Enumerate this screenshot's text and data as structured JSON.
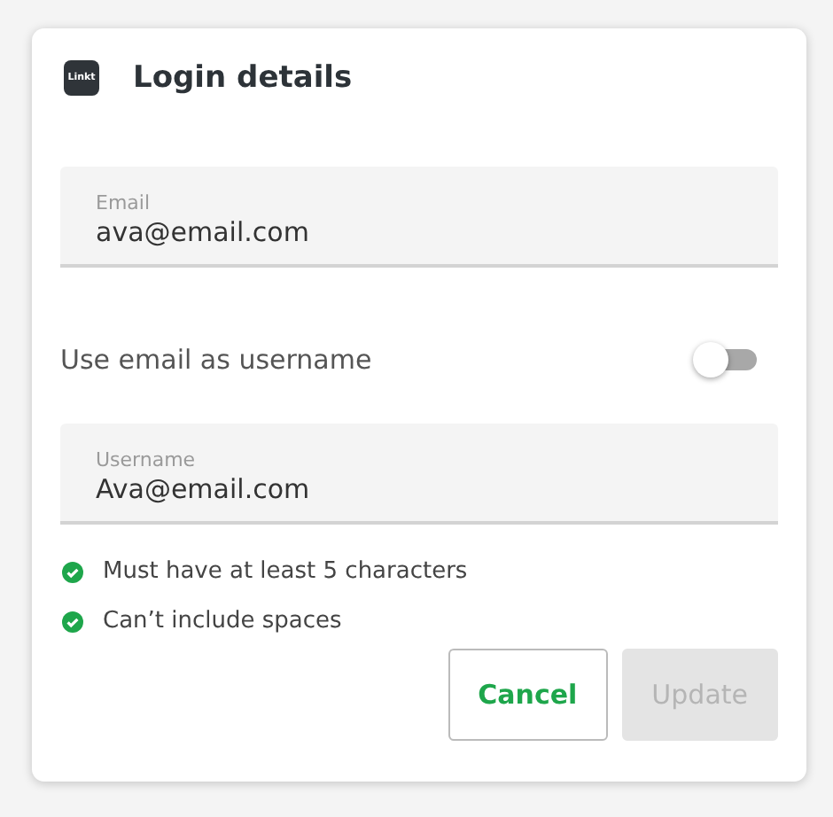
{
  "card": {
    "logo": "Linkt",
    "title": "Login details"
  },
  "fields": [
    {
      "kind": "text",
      "label": "Email",
      "value": "ava@email.com"
    },
    {
      "kind": "toggle",
      "label": "Use email as username",
      "on": false
    },
    {
      "kind": "text",
      "label": "Username",
      "value": "Ava@email.com"
    }
  ],
  "rules": [
    {
      "text": "Must have at least 5 characters",
      "met": true
    },
    {
      "text": "Can’t include spaces",
      "met": true
    }
  ],
  "buttons": [
    {
      "label": "Cancel",
      "disabled": false
    },
    {
      "label": "Update",
      "disabled": true
    }
  ]
}
